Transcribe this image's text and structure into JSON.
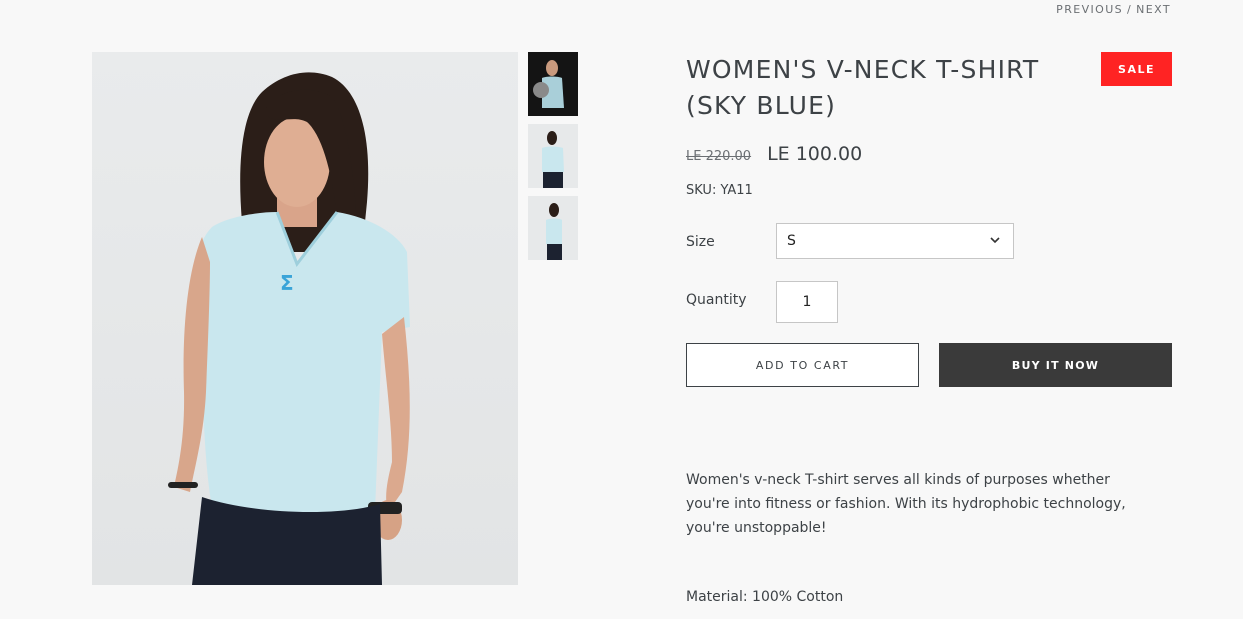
{
  "pagination": {
    "previous": "PREVIOUS",
    "separator": "/",
    "next": "NEXT"
  },
  "product": {
    "title": "WOMEN'S V-NECK T-SHIRT (SKY BLUE)",
    "badge": "SALE",
    "price_original": "LE 220.00",
    "price_sale": "LE 100.00",
    "sku": "SKU: YA11",
    "size_label": "Size",
    "size_selected": "S",
    "quantity_label": "Quantity",
    "quantity_value": "1",
    "add_to_cart": "ADD TO CART",
    "buy_now": "BUY IT NOW",
    "description": "Women's v-neck T-shirt serves all kinds of purposes whether you're into fitness or fashion. With its hydrophobic technology, you're unstoppable!",
    "material": "Material: 100% Cotton"
  },
  "colors": {
    "sale_badge": "#ff2323",
    "buy_button": "#3a3a3a",
    "shirt": "#c9e7ee",
    "logo": "#3aa4d8"
  },
  "icons": {
    "select_chevron": "chevron-down-icon"
  }
}
